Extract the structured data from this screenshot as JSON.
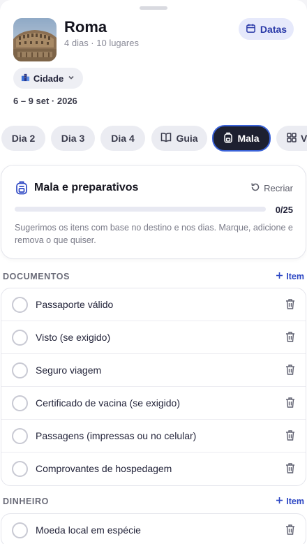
{
  "header": {
    "title": "Roma",
    "subtitle": "4 dias · 10 lugares",
    "dates_button": "Datas",
    "type_pill": "Cidade",
    "date_range": "6 – 9 set · 2026"
  },
  "tabs": [
    {
      "label": "Dia 2",
      "icon": ""
    },
    {
      "label": "Dia 3",
      "icon": ""
    },
    {
      "label": "Dia 4",
      "icon": ""
    },
    {
      "label": "Guia",
      "icon": "book-icon"
    },
    {
      "label": "Mala",
      "icon": "backpack-icon",
      "active": true
    },
    {
      "label": "V",
      "icon": "grid-icon"
    }
  ],
  "packing": {
    "title": "Mala e preparativos",
    "recreate_label": "Recriar",
    "progress_text": "0/25",
    "progress_fraction": 0,
    "description": "Sugerimos os itens com base no destino e nos dias. Marque, adicione e remova o que quiser."
  },
  "sections": [
    {
      "title": "DOCUMENTOS",
      "add_label": "Item",
      "items": [
        "Passaporte válido",
        "Visto (se exigido)",
        "Seguro viagem",
        "Certificado de vacina (se exigido)",
        "Passagens (impressas ou no celular)",
        "Comprovantes de hospedagem"
      ]
    },
    {
      "title": "DINHEIRO",
      "add_label": "Item",
      "items": [
        "Moeda local em espécie"
      ]
    }
  ],
  "colors": {
    "accent": "#2e48c4",
    "active_tab": "#1d2030",
    "dates_bg": "#e6e9fb"
  }
}
